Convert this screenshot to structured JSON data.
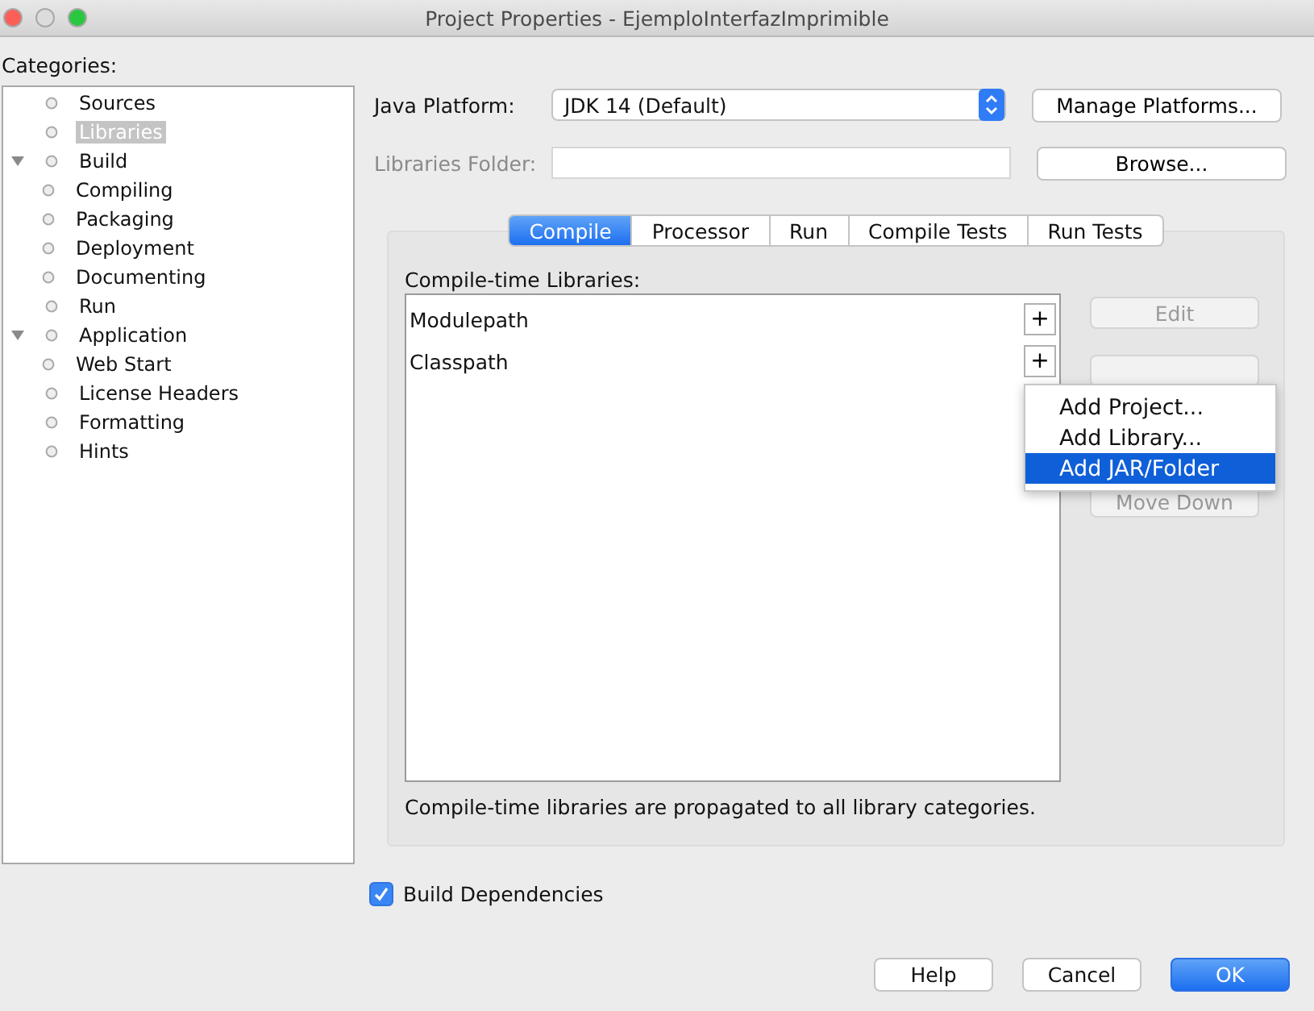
{
  "window": {
    "title": "Project Properties - EjemploInterfazImprimible"
  },
  "categories": {
    "label": "Categories:",
    "items": [
      {
        "label": "Sources",
        "selected": false
      },
      {
        "label": "Libraries",
        "selected": true
      },
      {
        "label": "Build",
        "selected": false,
        "expanded": true,
        "children": [
          {
            "label": "Compiling",
            "selected": false
          },
          {
            "label": "Packaging",
            "selected": false
          },
          {
            "label": "Deployment",
            "selected": false
          },
          {
            "label": "Documenting",
            "selected": false
          }
        ]
      },
      {
        "label": "Run",
        "selected": false
      },
      {
        "label": "Application",
        "selected": false,
        "expanded": true,
        "children": [
          {
            "label": "Web Start",
            "selected": false
          }
        ]
      },
      {
        "label": "License Headers",
        "selected": false
      },
      {
        "label": "Formatting",
        "selected": false
      },
      {
        "label": "Hints",
        "selected": false
      }
    ]
  },
  "java_platform": {
    "label": "Java Platform:",
    "value": "JDK 14 (Default)",
    "button": "Manage Platforms..."
  },
  "libraries_folder": {
    "label": "Libraries Folder:",
    "disabled": true,
    "button": "Browse..."
  },
  "tabs": [
    {
      "label": "Compile",
      "selected": true
    },
    {
      "label": "Processor",
      "selected": false
    },
    {
      "label": "Run",
      "selected": false
    },
    {
      "label": "Compile Tests",
      "selected": false
    },
    {
      "label": "Run Tests",
      "selected": false
    }
  ],
  "compile_libraries": {
    "label": "Compile-time Libraries:",
    "entries": [
      {
        "label": "Modulepath",
        "add": "+"
      },
      {
        "label": "Classpath",
        "add": "+"
      }
    ],
    "side_buttons": [
      {
        "label": "Edit",
        "disabled": true
      },
      {
        "label": "Move Down",
        "disabled": true
      }
    ],
    "note": "Compile-time libraries are propagated to all library categories."
  },
  "popup_menu": [
    {
      "label": "Add Project...",
      "selected": false
    },
    {
      "label": "Add Library...",
      "selected": false
    },
    {
      "label": "Add JAR/Folder",
      "selected": true
    }
  ],
  "build_dependencies": {
    "label": "Build Dependencies",
    "checked": true
  },
  "buttons": [
    {
      "label": "Help",
      "primary": false
    },
    {
      "label": "Cancel",
      "primary": false
    },
    {
      "label": "OK",
      "primary": true
    }
  ]
}
